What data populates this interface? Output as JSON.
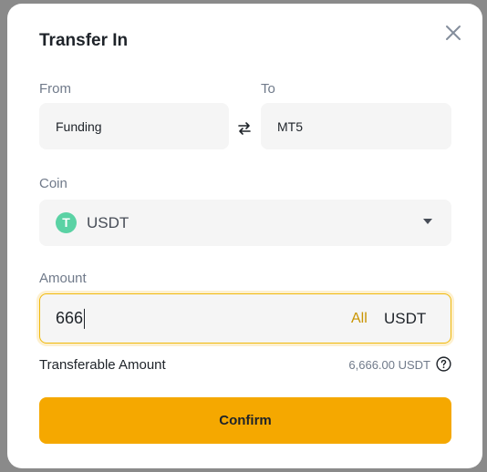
{
  "dialog": {
    "title": "Transfer In"
  },
  "from": {
    "label": "From",
    "value": "Funding"
  },
  "to": {
    "label": "To",
    "value": "MT5"
  },
  "coin": {
    "label": "Coin",
    "icon_letter": "T",
    "value": "USDT",
    "icon_color": "#5ad2a4"
  },
  "amount": {
    "label": "Amount",
    "value": "666",
    "all_label": "All",
    "unit": "USDT"
  },
  "transferable": {
    "label": "Transferable Amount",
    "value": "6,666.00 USDT"
  },
  "confirm_label": "Confirm",
  "colors": {
    "accent": "#f5a800",
    "all_link": "#c99400",
    "focus_border": "#f0b90b"
  },
  "icons": {
    "close": "close-icon",
    "swap": "swap-arrows-icon",
    "coin": "usdt-icon",
    "dropdown": "chevron-down-icon",
    "help": "help-circle-icon"
  }
}
